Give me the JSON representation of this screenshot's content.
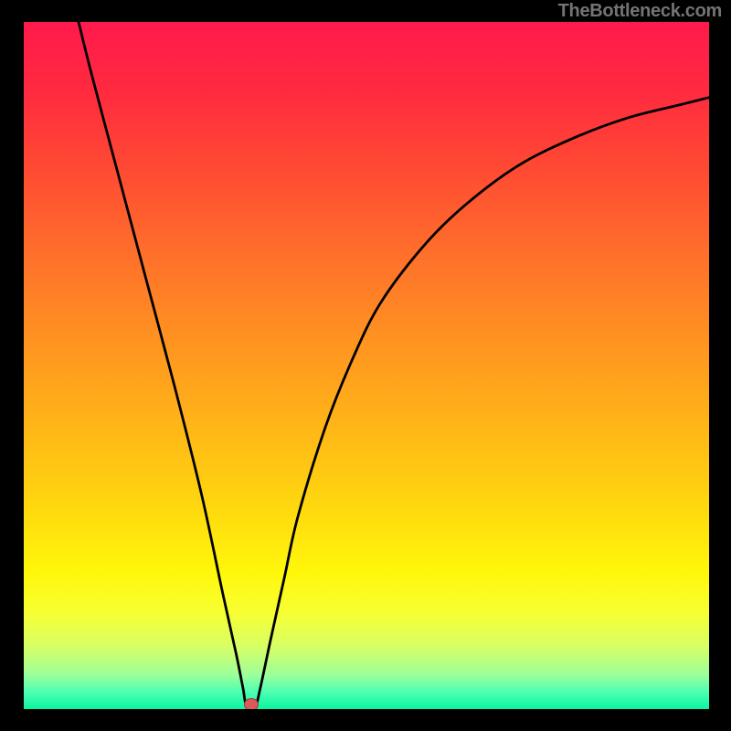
{
  "watermark": "TheBottleneck.com",
  "colors": {
    "page_bg": "#000000",
    "gradient_stops": [
      {
        "offset": 0.0,
        "color": "#ff1a4d"
      },
      {
        "offset": 0.1,
        "color": "#ff2a3f"
      },
      {
        "offset": 0.2,
        "color": "#ff4634"
      },
      {
        "offset": 0.32,
        "color": "#ff6a2c"
      },
      {
        "offset": 0.45,
        "color": "#ff8f22"
      },
      {
        "offset": 0.58,
        "color": "#ffb318"
      },
      {
        "offset": 0.7,
        "color": "#ffd60f"
      },
      {
        "offset": 0.8,
        "color": "#fff70a"
      },
      {
        "offset": 0.86,
        "color": "#f7ff33"
      },
      {
        "offset": 0.91,
        "color": "#d6ff66"
      },
      {
        "offset": 0.95,
        "color": "#9dff99"
      },
      {
        "offset": 0.975,
        "color": "#4dffb3"
      },
      {
        "offset": 1.0,
        "color": "#0cf59f"
      }
    ],
    "curve": "#000000",
    "marker_fill": "#d85a5a"
  },
  "chart_data": {
    "type": "line",
    "title": "",
    "xlabel": "",
    "ylabel": "",
    "xlim": [
      0,
      100
    ],
    "ylim": [
      0,
      100
    ],
    "series": [
      {
        "name": "bottleneck-curve",
        "points": [
          {
            "x": 8,
            "y": 100
          },
          {
            "x": 10,
            "y": 92
          },
          {
            "x": 14,
            "y": 77
          },
          {
            "x": 18,
            "y": 62
          },
          {
            "x": 22,
            "y": 47
          },
          {
            "x": 26,
            "y": 31
          },
          {
            "x": 29,
            "y": 17
          },
          {
            "x": 31,
            "y": 8
          },
          {
            "x": 32,
            "y": 3
          },
          {
            "x": 32.5,
            "y": 0.5
          },
          {
            "x": 33.8,
            "y": 0.5
          },
          {
            "x": 34.5,
            "y": 3
          },
          {
            "x": 36,
            "y": 10
          },
          {
            "x": 38,
            "y": 19
          },
          {
            "x": 40,
            "y": 28
          },
          {
            "x": 44,
            "y": 41
          },
          {
            "x": 48,
            "y": 51
          },
          {
            "x": 52,
            "y": 59
          },
          {
            "x": 58,
            "y": 67
          },
          {
            "x": 64,
            "y": 73
          },
          {
            "x": 72,
            "y": 79
          },
          {
            "x": 80,
            "y": 83
          },
          {
            "x": 88,
            "y": 86
          },
          {
            "x": 96,
            "y": 88
          },
          {
            "x": 100,
            "y": 89
          }
        ]
      }
    ],
    "annotations": [
      {
        "name": "optimum-marker",
        "x": 33.2,
        "y": 0.6
      }
    ]
  }
}
